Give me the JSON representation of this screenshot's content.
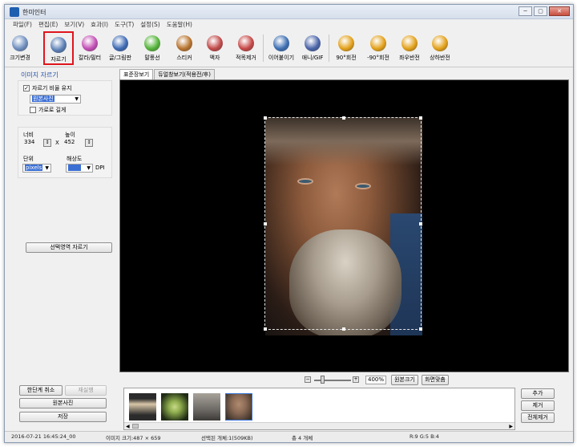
{
  "window": {
    "title": "한미인터"
  },
  "window_buttons": [
    "─",
    "▢",
    "✕"
  ],
  "menu": [
    "파일(F)",
    "편집(E)",
    "보기(V)",
    "효과(I)",
    "도구(T)",
    "설정(S)",
    "도움말(H)"
  ],
  "toolbar": [
    {
      "label": "크기변경",
      "icon": "resize-icon",
      "color": "#6f8fbf"
    },
    {
      "label": "자르기",
      "icon": "crop-icon",
      "color": "#5a7fb5"
    },
    {
      "label": "칼라/필터",
      "icon": "color-filter-icon",
      "color": "#c34fb5"
    },
    {
      "label": "글/그림판",
      "icon": "text-draw-icon",
      "color": "#3f6bb5"
    },
    {
      "label": "말풍선",
      "icon": "speech-bubble-icon",
      "color": "#55b43a"
    },
    {
      "label": "스티커",
      "icon": "sticker-icon",
      "color": "#b8742e"
    },
    {
      "label": "액자",
      "icon": "frame-icon",
      "color": "#c24a4a"
    },
    {
      "label": "적목제거",
      "icon": "red-eye-icon",
      "color": "#c74848"
    },
    {
      "label": "이어붙이기",
      "icon": "merge-icon",
      "color": "#3d6fb3"
    },
    {
      "label": "애니/GIF",
      "icon": "animation-icon",
      "color": "#4a64a8"
    },
    {
      "label": "90°회전",
      "icon": "rotate-right-icon",
      "color": "#e3a11a"
    },
    {
      "label": "-90°회전",
      "icon": "rotate-left-icon",
      "color": "#e3a11a"
    },
    {
      "label": "좌우반전",
      "icon": "flip-horizontal-icon",
      "color": "#e3a11a"
    },
    {
      "label": "상하반전",
      "icon": "flip-vertical-icon",
      "color": "#e3a11a"
    }
  ],
  "crop_panel": {
    "title": "이미지 자르기",
    "keep_ratio_label": "자르기 비율 유지",
    "keep_ratio_checked": true,
    "ratio_select": "원본사진",
    "landscape_label": "가로로 길게",
    "landscape_checked": false,
    "width_label": "너비",
    "height_label": "높이",
    "width_value": "334",
    "height_value": "452",
    "x_label": "X",
    "unit_label": "단위",
    "unit_value": "pixels",
    "resolution_label": "해상도",
    "resolution_value": "",
    "dpi_label": "DPI",
    "crop_button": "선택영역 자르기"
  },
  "bottom_left": {
    "undo": "한단계 취소",
    "redo": "재실행",
    "original": "원본사진",
    "save": "저장"
  },
  "tabs": [
    "표준장보기",
    "듀얼창보기(적용전/후)"
  ],
  "zoom": {
    "value": "400%",
    "actual_size": "원본크기",
    "fit": "화면맞춤",
    "slider_level": 0.25
  },
  "thumbnail_buttons": {
    "add": "추가",
    "remove": "제거",
    "remove_all": "전체제거"
  },
  "thumbnails": [
    {
      "name": "thumbnail-1",
      "c1": "#d8c6a8",
      "c2": "#2b2b2b"
    },
    {
      "name": "thumbnail-2",
      "c1": "#8fae4e",
      "c2": "#1f2b14"
    },
    {
      "name": "thumbnail-3",
      "c1": "#6d6a66",
      "c2": "#a8a39a"
    },
    {
      "name": "thumbnail-4",
      "c1": "#8a6a55",
      "c2": "#3a3028"
    }
  ],
  "status": {
    "datetime": "2016-07-21 16:45:24_00",
    "image_size": "이미지 크기:487 × 659",
    "selected": "선택된 개체:1(509KB)",
    "total": "총 4 개체",
    "rgb": "R:9 G:5 B:4"
  }
}
